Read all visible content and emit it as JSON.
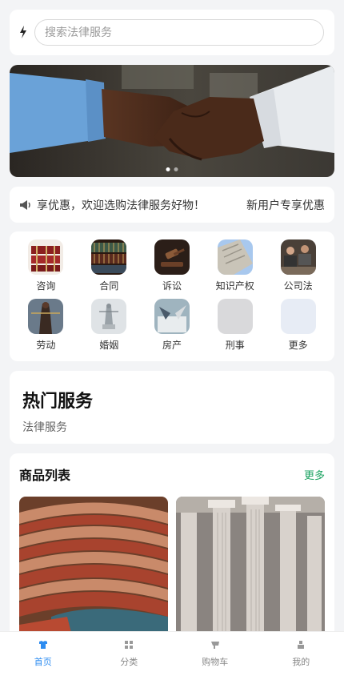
{
  "search": {
    "placeholder": "搜索法律服务",
    "logo_icon": "lightning-icon"
  },
  "banner": {
    "image": "handshake-photo",
    "dot_count": 2,
    "active_dot": 0
  },
  "notice": {
    "icon": "megaphone-icon",
    "text": "享优惠，欢迎选购法律服务好物！",
    "right_text": "新用户专享优惠"
  },
  "categories": [
    {
      "label": "咨询"
    },
    {
      "label": "合同"
    },
    {
      "label": "诉讼"
    },
    {
      "label": "知识产权"
    },
    {
      "label": "公司法"
    },
    {
      "label": "劳动"
    },
    {
      "label": "婚姻"
    },
    {
      "label": "房产"
    },
    {
      "label": "刑事"
    },
    {
      "label": "更多"
    }
  ],
  "hot": {
    "title": "热门服务",
    "subtitle": "法律服务"
  },
  "products": {
    "title": "商品列表",
    "more": "更多",
    "items": [
      {
        "image": "parliament-chamber-photo"
      },
      {
        "image": "classical-columns-photo"
      }
    ]
  },
  "tabbar": [
    {
      "label": "首页",
      "icon": "shirt-icon",
      "active": true
    },
    {
      "label": "分类",
      "icon": "grid-icon",
      "active": false
    },
    {
      "label": "购物车",
      "icon": "cart-icon",
      "active": false
    },
    {
      "label": "我的",
      "icon": "user-icon",
      "active": false
    }
  ],
  "colors": {
    "accent": "#2d8cf0",
    "more_link": "#1aa260",
    "background": "#f3f4f6"
  }
}
